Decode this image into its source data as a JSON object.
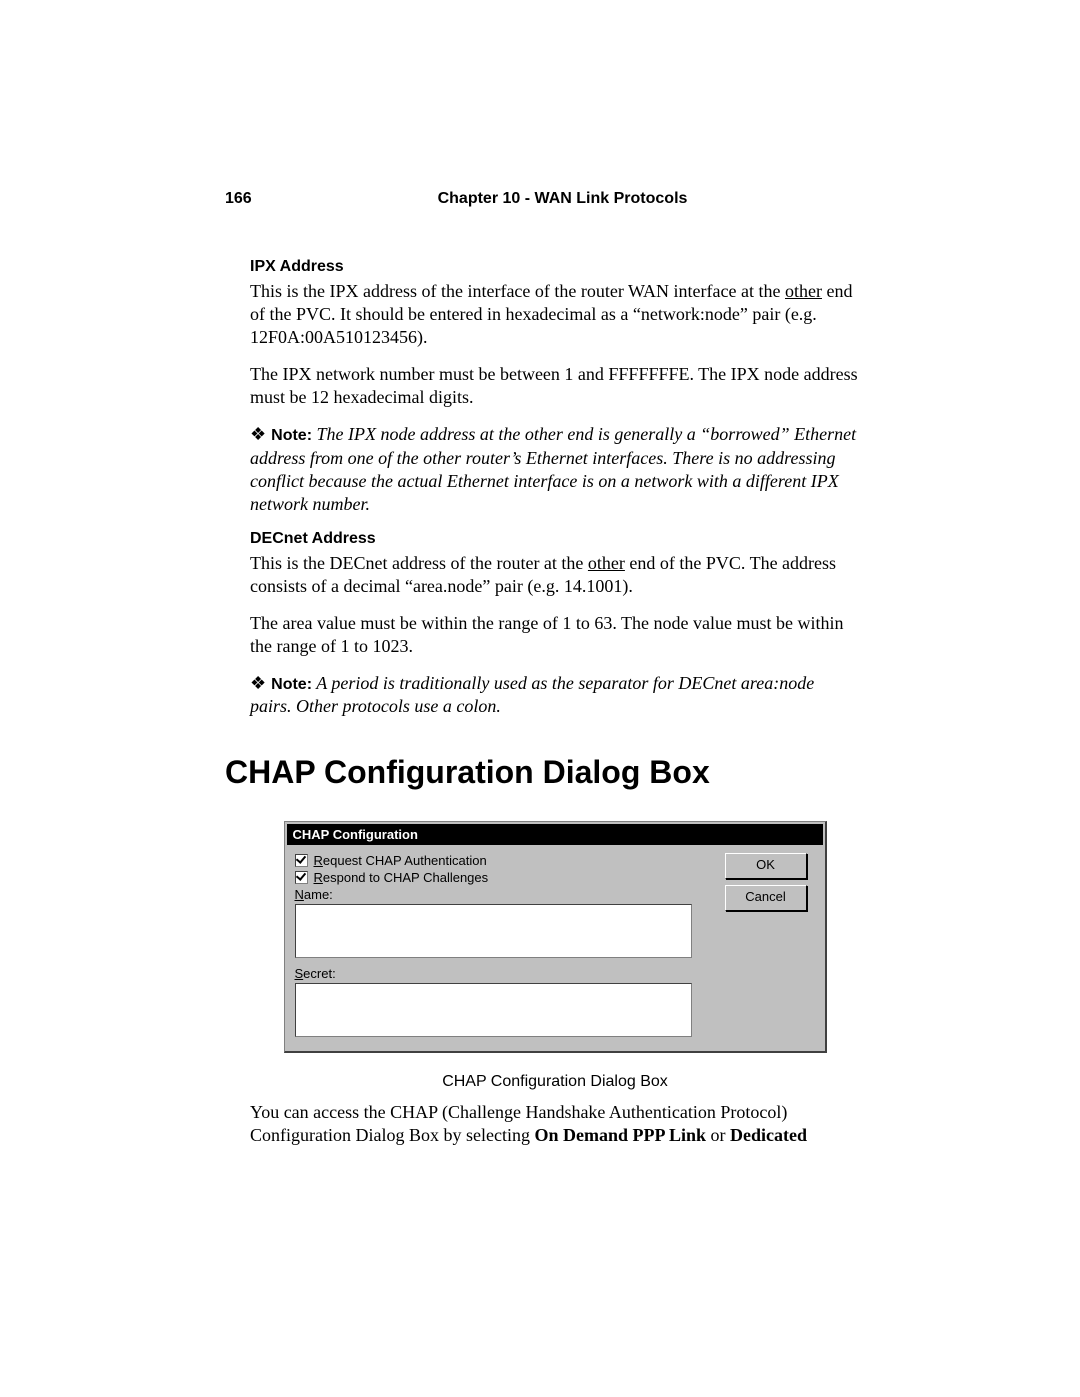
{
  "header": {
    "page_number": "166",
    "chapter": "Chapter 10 - WAN Link Protocols"
  },
  "ipx": {
    "heading": "IPX Address",
    "p1a": "This is the IPX address of the interface of the router WAN interface at the ",
    "p1_other": "other",
    "p1b": " end of the PVC. It should be entered in hexadecimal as a “network:node” pair (e.g. 12F0A:00A510123456).",
    "p2": "The IPX network number must be between 1 and FFFFFFFE. The IPX node address must be 12 hexadecimal digits.",
    "note_label": "Note:",
    "note": "The IPX node address at the other end is generally a “borrowed” Ethernet address from one of the other router’s Ethernet interfaces. There is no addressing conflict because the actual Ethernet interface is on a network with a different IPX network number."
  },
  "decnet": {
    "heading": "DECnet Address",
    "p1a": "This is the DECnet address of the router at the ",
    "p1_other": "other",
    "p1b": " end of the PVC. The address consists of a decimal “area.node” pair (e.g. 14.1001).",
    "p2": "The area value must be within the range of 1 to 63. The node value must be within the range of 1 to 1023.",
    "note_label": "Note:",
    "note": "A period is traditionally used as the separator for DECnet area:node pairs. Other protocols use a colon."
  },
  "chap": {
    "h1": "CHAP Configuration Dialog Box",
    "dialog": {
      "title": "CHAP Configuration",
      "request_accel": "R",
      "request_rest": "equest CHAP Authentication",
      "respond_accel": "R",
      "respond_rest": "espond to CHAP Challenges",
      "name_accel": "N",
      "name_rest": "ame:",
      "secret_accel": "S",
      "secret_rest": "ecret:",
      "ok": "OK",
      "cancel": "Cancel"
    },
    "caption": "CHAP Configuration Dialog Box",
    "p_a": "You can access the CHAP (Challenge Handshake Authentication Protocol) Configuration Dialog Box by selecting ",
    "p_b1": "On Demand PPP Link",
    "p_or": " or ",
    "p_b2": "Dedicated"
  }
}
